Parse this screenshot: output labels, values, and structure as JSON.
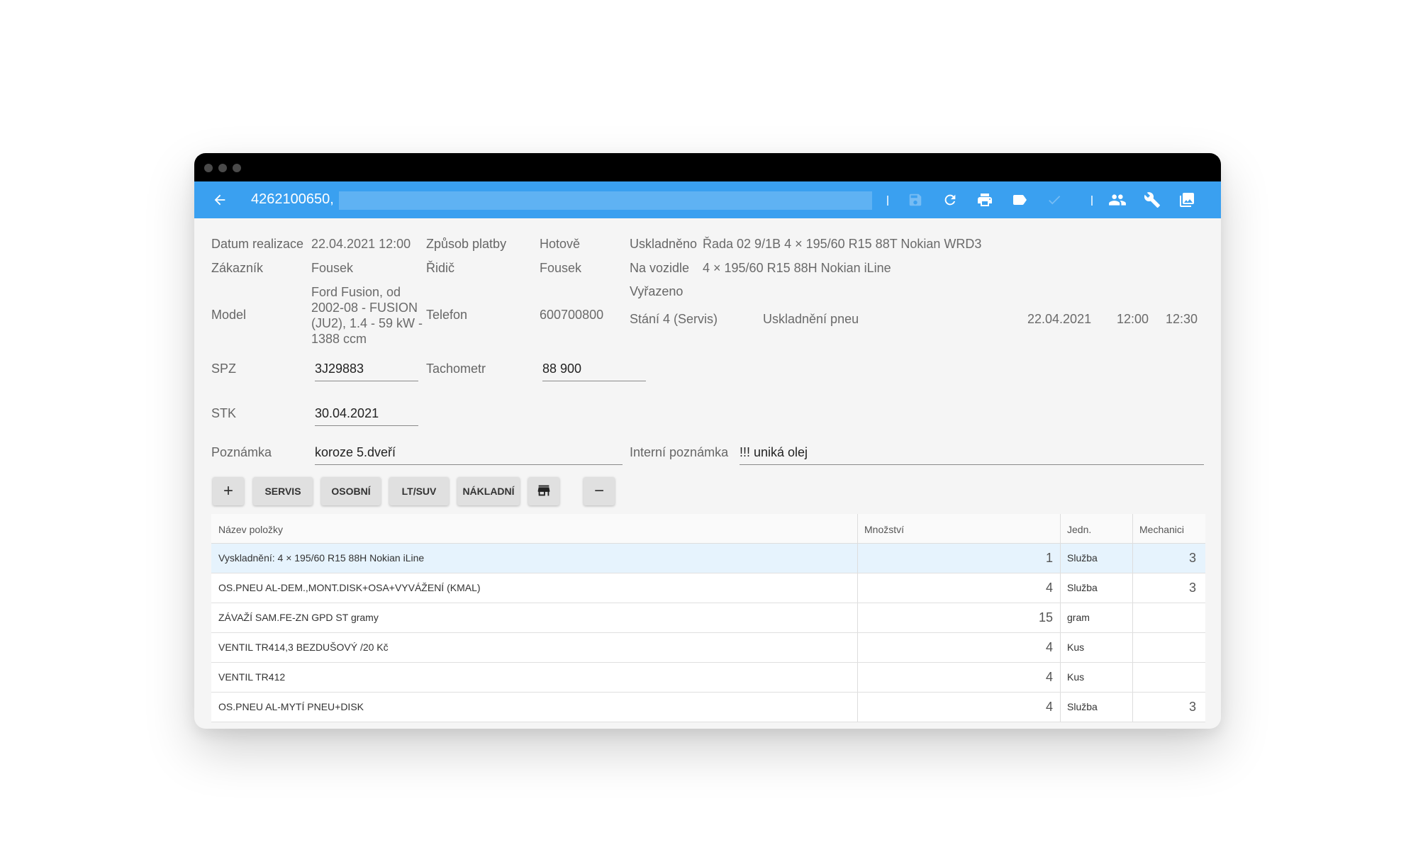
{
  "appbar": {
    "title": "4262100650,",
    "icons": [
      "back-arrow-icon",
      "save-icon",
      "refresh-icon",
      "print-icon",
      "label-icon",
      "check-icon",
      "people-icon",
      "wrench-icon",
      "gallery-icon"
    ]
  },
  "form": {
    "datum_realizace_label": "Datum realizace",
    "datum_realizace": "22.04.2021 12:00",
    "zpusob_platby_label": "Způsob platby",
    "zpusob_platby": "Hotově",
    "zakaznik_label": "Zákazník",
    "zakaznik": "Fousek",
    "ridic_label": "Řidič",
    "ridic": "Fousek",
    "model_label": "Model",
    "model": "Ford Fusion, od 2002-08 - FUSION (JU2), 1.4 - 59 kW - 1388 ccm",
    "telefon_label": "Telefon",
    "telefon": "600700800",
    "spz_label": "SPZ",
    "spz": "3J29883",
    "tachometr_label": "Tachometr",
    "tachometr": "88 900",
    "stk_label": "STK",
    "stk": "30.04.2021",
    "poznamka_label": "Poznámka",
    "poznamka": "koroze 5.dveří",
    "interni_poznamka_label": "Interní poznámka",
    "interni_poznamka": "!!! uniká olej"
  },
  "storage": {
    "uskladneno_label": "Uskladněno",
    "uskladneno": "Řada 02 9/1B 4 × 195/60 R15 88T Nokian WRD3",
    "na_vozidle_label": "Na vozidle",
    "na_vozidle": "4 × 195/60 R15 88H Nokian iLine",
    "vyrazeno_label": "Vyřazeno"
  },
  "booking": {
    "stani": "Stání 4 (Servis)",
    "typ": "Uskladnění pneu",
    "datum": "22.04.2021",
    "od": "12:00",
    "do": "12:30"
  },
  "buttons": {
    "add": "+",
    "servis": "SERVIS",
    "osobni": "OSOBNÍ",
    "lt_suv": "LT/SUV",
    "nakladni": "NÁKLADNÍ",
    "remove": "−"
  },
  "table": {
    "headers": [
      "Název položky",
      "Množství",
      "Jedn.",
      "Mechanici"
    ],
    "rows": [
      {
        "name": "Vyskladnění: 4 × 195/60 R15 88H Nokian iLine",
        "qty": "1",
        "unit": "Služba",
        "mech": "3"
      },
      {
        "name": "OS.PNEU AL-DEM.,MONT.DISK+OSA+VYVÁŽENÍ (KMAL)",
        "qty": "4",
        "unit": "Služba",
        "mech": "3"
      },
      {
        "name": "ZÁVAŽÍ SAM.FE-ZN GPD ST gramy",
        "qty": "15",
        "unit": "gram",
        "mech": ""
      },
      {
        "name": "VENTIL TR414,3 BEZDUŠOVÝ  /20 Kč",
        "qty": "4",
        "unit": "Kus",
        "mech": ""
      },
      {
        "name": "VENTIL TR412",
        "qty": "4",
        "unit": "Kus",
        "mech": ""
      },
      {
        "name": "OS.PNEU AL-MYTÍ PNEU+DISK",
        "qty": "4",
        "unit": "Služba",
        "mech": "3"
      }
    ]
  }
}
